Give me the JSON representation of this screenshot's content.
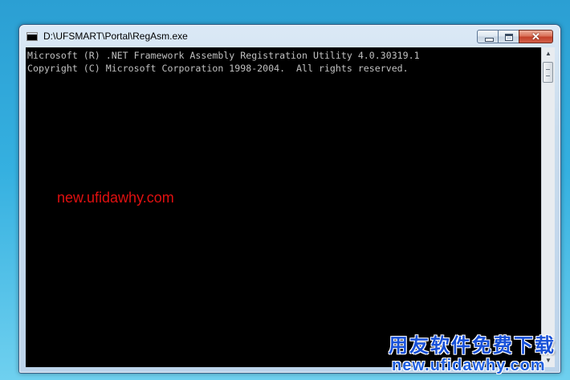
{
  "window": {
    "title": "D:\\UFSMART\\Portal\\RegAsm.exe",
    "close_glyph": "✕"
  },
  "console": {
    "lines": [
      "Microsoft (R) .NET Framework Assembly Registration Utility 4.0.30319.1",
      "Copyright (C) Microsoft Corporation 1998-2004.  All rights reserved."
    ]
  },
  "scrollbar": {
    "up_arrow": "▲",
    "down_arrow": "▼"
  },
  "watermarks": {
    "red_url": "new.ufidawhy.com",
    "brand_cn": "用友软件免费下载",
    "brand_url": "new.ufidawhy.com"
  },
  "colors": {
    "console_bg": "#000000",
    "console_text": "#c0c0c0",
    "watermark_red": "#e01010",
    "watermark_blue": "#1750d8"
  }
}
